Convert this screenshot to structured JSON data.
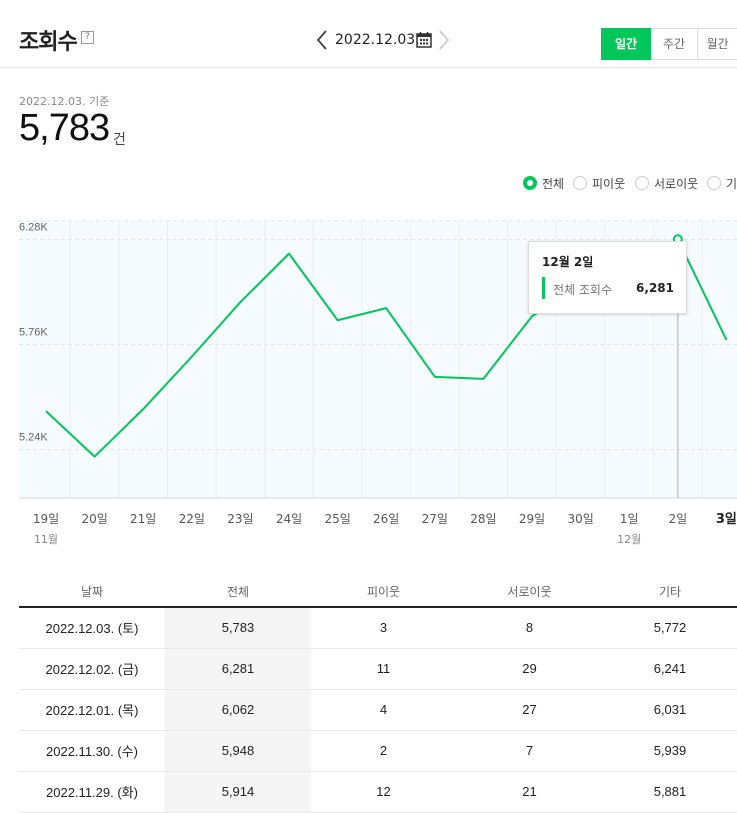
{
  "header": {
    "title": "조회수",
    "help_icon": "?",
    "date": "2022.12.03.",
    "period_tabs": [
      "일간",
      "주간",
      "월간"
    ],
    "active_tab": "일간"
  },
  "summary": {
    "basis": "2022.12.03. 기준",
    "value": "5,783",
    "unit": "건"
  },
  "legend": {
    "items": [
      {
        "label": "전체",
        "selected": true
      },
      {
        "label": "피이웃",
        "selected": false
      },
      {
        "label": "서로이웃",
        "selected": false
      },
      {
        "label": "기",
        "selected": false
      }
    ]
  },
  "colors": {
    "accent": "#03c75a",
    "chart_bg": "#f5fbfe"
  },
  "chart_data": {
    "type": "line",
    "x": [
      "19일",
      "20일",
      "21일",
      "22일",
      "23일",
      "24일",
      "25일",
      "26일",
      "27일",
      "28일",
      "29일",
      "30일",
      "1일",
      "2일",
      "3일"
    ],
    "x_month_labels": [
      {
        "at": "19일",
        "label": "11월"
      },
      {
        "at": "1일",
        "label": "12월"
      }
    ],
    "series": [
      {
        "values": [
          5430,
          5205,
          5440,
          5700,
          5970,
          6210,
          5880,
          5940,
          5600,
          5590,
          5900,
          6050,
          6110,
          6281,
          5783
        ]
      }
    ],
    "y_ticks": [
      "5.24K",
      "5.76K",
      "6.28K"
    ],
    "ylim": [
      5000,
      6370
    ],
    "highlight": {
      "label": "3일"
    },
    "tooltip": {
      "title": "12월 2일",
      "label": "전체 조회수",
      "value": "6,281"
    }
  },
  "table": {
    "headers": [
      "날짜",
      "전체",
      "피이웃",
      "서로이웃",
      "기타"
    ],
    "rows": [
      [
        "2022.12.03. (토)",
        "5,783",
        "3",
        "8",
        "5,772"
      ],
      [
        "2022.12.02. (금)",
        "6,281",
        "11",
        "29",
        "6,241"
      ],
      [
        "2022.12.01. (목)",
        "6,062",
        "4",
        "27",
        "6,031"
      ],
      [
        "2022.11.30. (수)",
        "5,948",
        "2",
        "7",
        "5,939"
      ],
      [
        "2022.11.29. (화)",
        "5,914",
        "12",
        "21",
        "5,881"
      ]
    ]
  }
}
